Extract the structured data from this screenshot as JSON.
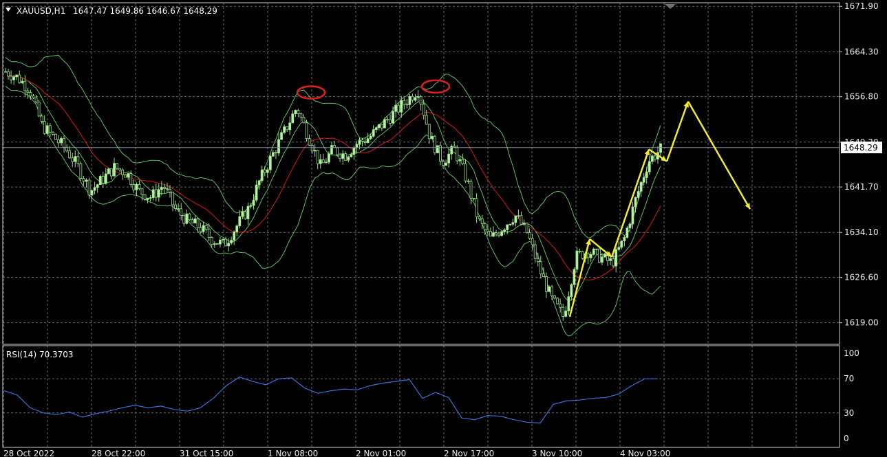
{
  "header": {
    "symbol": "XAUUSD,H1",
    "ohlc": "1647.47 1649.86 1646.67 1648.29"
  },
  "rsi_panel": {
    "label": "RSI(14) 70.3703"
  },
  "current_price": "1648.29",
  "colors": {
    "background": "#000000",
    "grid": "#6a6a6a",
    "bull_candle": "#b8f5a0",
    "bear_candle": "#000000",
    "wick": "#9be08a",
    "bollinger": "#5fbf5f",
    "moving_average": "#d81818",
    "rsi_line": "#3b6fd8",
    "annotation_arrow": "#f2ec2a",
    "annotation_circle": "#e02020",
    "bid_line": "#7d8fa8"
  },
  "chart_data": [
    {
      "type": "candlestick",
      "title": "XAUUSD,H1",
      "x_ticks": [
        "28 Oct 2022",
        "28 Oct 22:00",
        "31 Oct 15:00",
        "1 Nov 08:00",
        "2 Nov 01:00",
        "2 Nov 17:00",
        "3 Nov 10:00",
        "4 Nov 03:00"
      ],
      "y_ticks": [
        "1671.90",
        "1664.30",
        "1656.80",
        "1649.20",
        "1641.70",
        "1634.10",
        "1626.60",
        "1619.00"
      ],
      "ylim": [
        1615.4,
        1672.5
      ],
      "grid": true,
      "last_price": 1648.29,
      "price_path": [
        1661,
        1660,
        1658,
        1652,
        1650,
        1648,
        1645,
        1641,
        1643,
        1645,
        1644,
        1641,
        1640,
        1642,
        1638,
        1636,
        1635,
        1633,
        1632,
        1635,
        1638,
        1643,
        1647,
        1651,
        1655,
        1650,
        1645,
        1648,
        1647,
        1649,
        1650,
        1652,
        1654,
        1656,
        1658,
        1650,
        1646,
        1648,
        1643,
        1636,
        1633,
        1635,
        1637,
        1634,
        1628,
        1623,
        1620,
        1630,
        1631,
        1630,
        1629,
        1633,
        1640,
        1646,
        1648
      ],
      "annotations": {
        "circled_tops": [
          1657.5,
          1658.5
        ],
        "forecast_path": [
          1620,
          1633,
          1630,
          1648,
          1646,
          1656,
          1638
        ]
      }
    },
    {
      "type": "line",
      "title": "RSI(14) 70.3703",
      "y_ticks": [
        "100",
        "70",
        "30",
        "0"
      ],
      "ylim": [
        0,
        100
      ],
      "levels": [
        70,
        30
      ],
      "values": [
        56,
        51,
        36,
        30,
        28,
        31,
        25,
        29,
        32,
        36,
        39,
        36,
        38,
        34,
        32,
        36,
        47,
        62,
        72,
        67,
        63,
        70,
        71,
        59,
        53,
        56,
        58,
        57,
        62,
        65,
        67,
        69,
        47,
        54,
        48,
        24,
        22,
        27,
        26,
        22,
        19,
        18,
        40,
        44,
        45,
        47,
        48,
        52,
        62,
        70,
        70
      ]
    }
  ]
}
